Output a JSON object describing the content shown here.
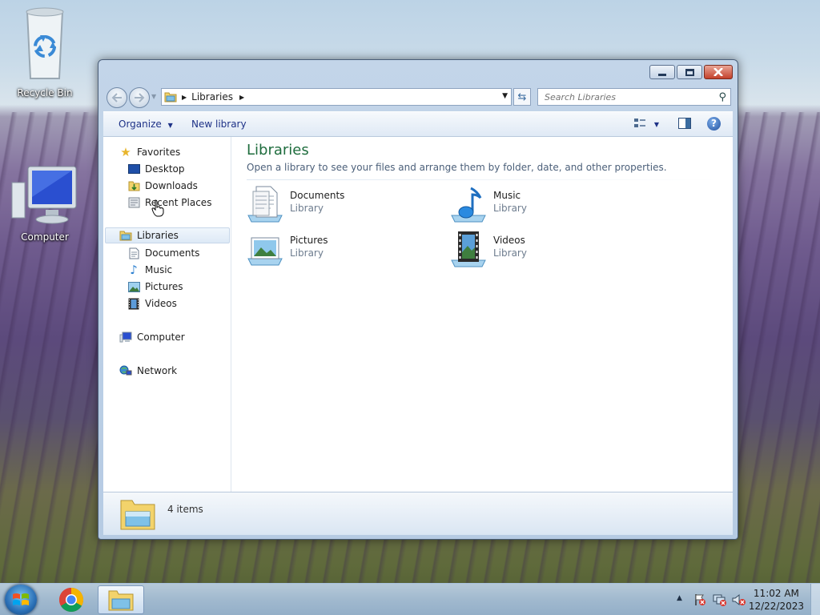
{
  "desktop": {
    "icons": [
      {
        "label": "Recycle Bin",
        "icon": "recycle-bin-icon"
      },
      {
        "label": "Computer",
        "icon": "computer-icon"
      }
    ]
  },
  "window": {
    "address": {
      "crumb": "Libraries"
    },
    "search": {
      "placeholder": "Search Libraries"
    },
    "toolbar": {
      "organize": "Organize",
      "new_library": "New library"
    },
    "nav": {
      "favorites": "Favorites",
      "desktop": "Desktop",
      "downloads": "Downloads",
      "recent_places": "Recent Places",
      "libraries": "Libraries",
      "documents": "Documents",
      "music": "Music",
      "pictures": "Pictures",
      "videos": "Videos",
      "computer": "Computer",
      "network": "Network"
    },
    "main": {
      "title": "Libraries",
      "subtitle": "Open a library to see your files and arrange them by folder, date, and other properties.",
      "libraries": [
        {
          "name": "Documents",
          "type": "Library"
        },
        {
          "name": "Music",
          "type": "Library"
        },
        {
          "name": "Pictures",
          "type": "Library"
        },
        {
          "name": "Videos",
          "type": "Library"
        }
      ]
    },
    "details": {
      "count": "4 items"
    }
  },
  "taskbar": {
    "clock_time": "11:02 AM",
    "clock_date": "12/22/2023"
  }
}
